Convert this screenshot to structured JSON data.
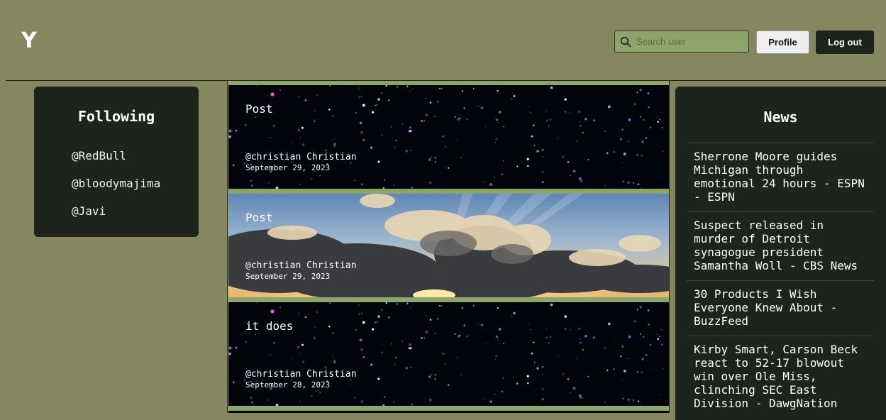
{
  "header": {
    "logo": "Y",
    "search_placeholder": "Search user",
    "profile_label": "Profile",
    "logout_label": "Log out"
  },
  "following": {
    "title": "Following",
    "users": [
      "@RedBull",
      "@bloodymajima",
      "@Javi"
    ]
  },
  "feed": {
    "posts": [
      {
        "title": "Post",
        "author": "@christian Christian",
        "date": "September 29, 2023",
        "background": "starfield"
      },
      {
        "title": "Post",
        "author": "@christian Christian",
        "date": "September 29, 2023",
        "background": "sunset-clouds"
      },
      {
        "title": "it does",
        "author": "@christian Christian",
        "date": "September 28, 2023",
        "background": "starfield"
      }
    ]
  },
  "news": {
    "title": "News",
    "articles": [
      "Sherrone Moore guides Michigan through emotional 24 hours - ESPN - ESPN",
      "Suspect released in murder of Detroit synagogue president Samantha Woll - CBS News",
      "30 Products I Wish Everyone Knew About - BuzzFeed",
      "Kirby Smart, Carson Beck react to 52-17 blowout win over Ole Miss, clinching SEC East Division - DawgNation"
    ]
  },
  "colors": {
    "page_bg": "#868660",
    "panel_bg": "#1c241c",
    "feed_bg": "#8da56c",
    "search_bg": "#8da56c"
  }
}
